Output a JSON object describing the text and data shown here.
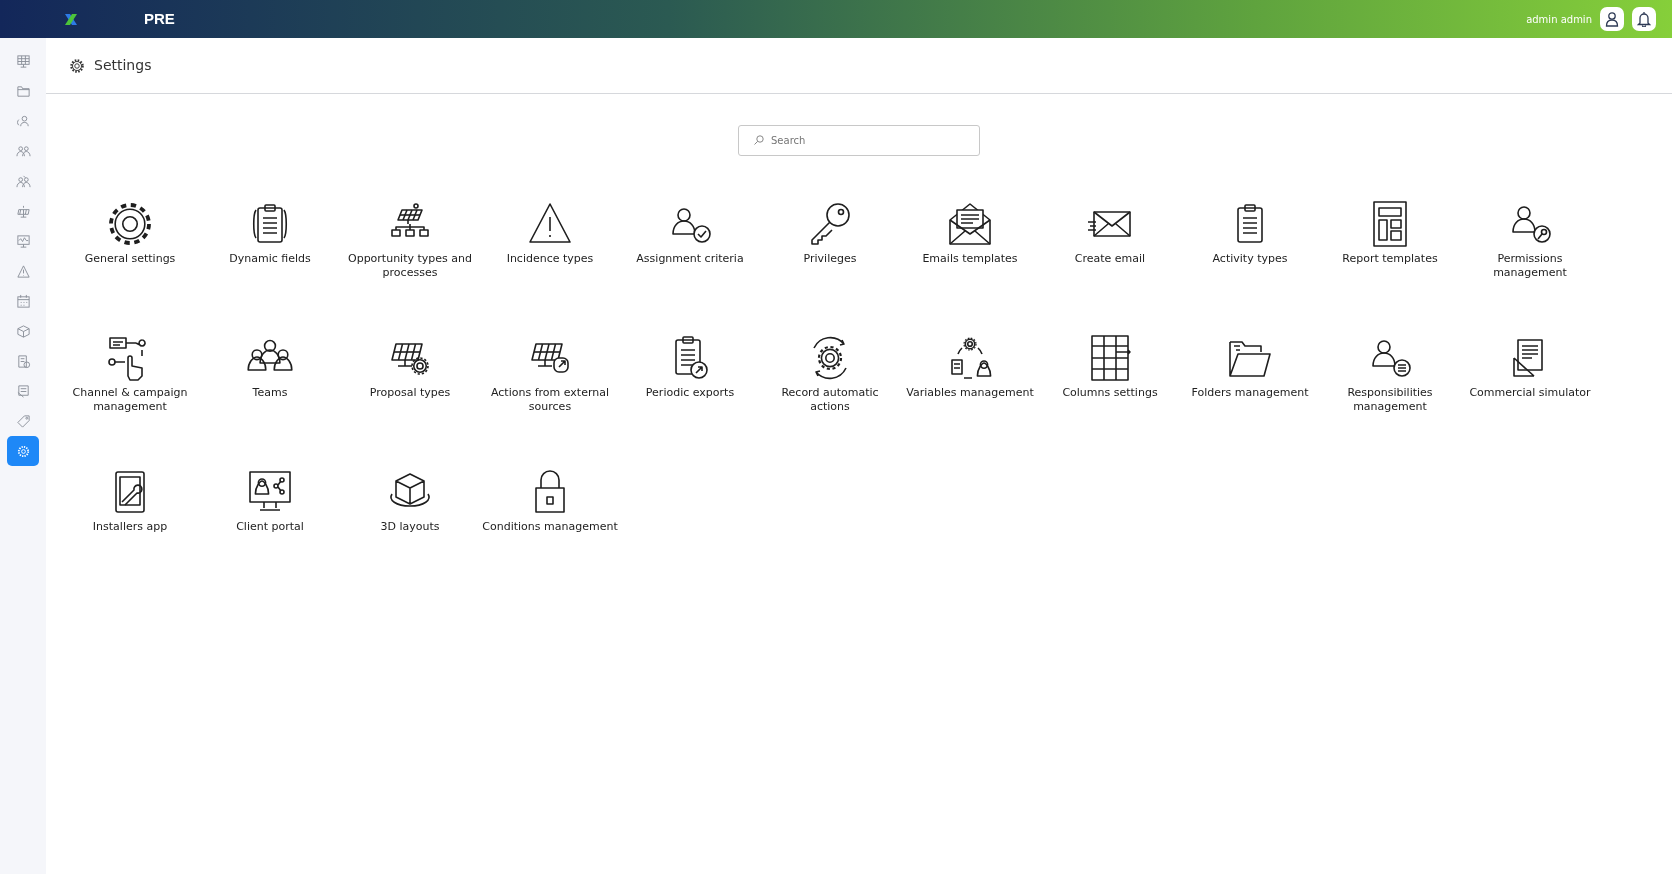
{
  "header": {
    "environment": "PRE",
    "user": "admin admin"
  },
  "sidebar": {
    "items": [
      {
        "selected": false
      },
      {
        "selected": false
      },
      {
        "selected": false
      },
      {
        "selected": false
      },
      {
        "selected": false
      },
      {
        "selected": false
      },
      {
        "selected": false
      },
      {
        "selected": false
      },
      {
        "selected": false
      },
      {
        "selected": false
      },
      {
        "selected": false
      },
      {
        "selected": false
      },
      {
        "selected": false
      },
      {
        "selected": true
      }
    ]
  },
  "page": {
    "title": "Settings"
  },
  "search": {
    "placeholder": "Search"
  },
  "tiles": [
    {
      "label": "General settings"
    },
    {
      "label": "Dynamic fields"
    },
    {
      "label": "Opportunity types and processes"
    },
    {
      "label": "Incidence types"
    },
    {
      "label": "Assignment criteria"
    },
    {
      "label": "Privileges"
    },
    {
      "label": "Emails templates"
    },
    {
      "label": "Create email"
    },
    {
      "label": "Activity types"
    },
    {
      "label": "Report templates"
    },
    {
      "label": "Permissions management"
    },
    {
      "label": "Channel & campaign management"
    },
    {
      "label": "Teams"
    },
    {
      "label": "Proposal types"
    },
    {
      "label": "Actions from external sources"
    },
    {
      "label": "Periodic exports"
    },
    {
      "label": "Record automatic actions"
    },
    {
      "label": "Variables management"
    },
    {
      "label": "Columns settings"
    },
    {
      "label": "Folders management"
    },
    {
      "label": "Responsibilities management"
    },
    {
      "label": "Commercial simulator"
    },
    {
      "label": "Installers app"
    },
    {
      "label": "Client portal"
    },
    {
      "label": "3D layouts"
    },
    {
      "label": "Conditions management"
    }
  ]
}
